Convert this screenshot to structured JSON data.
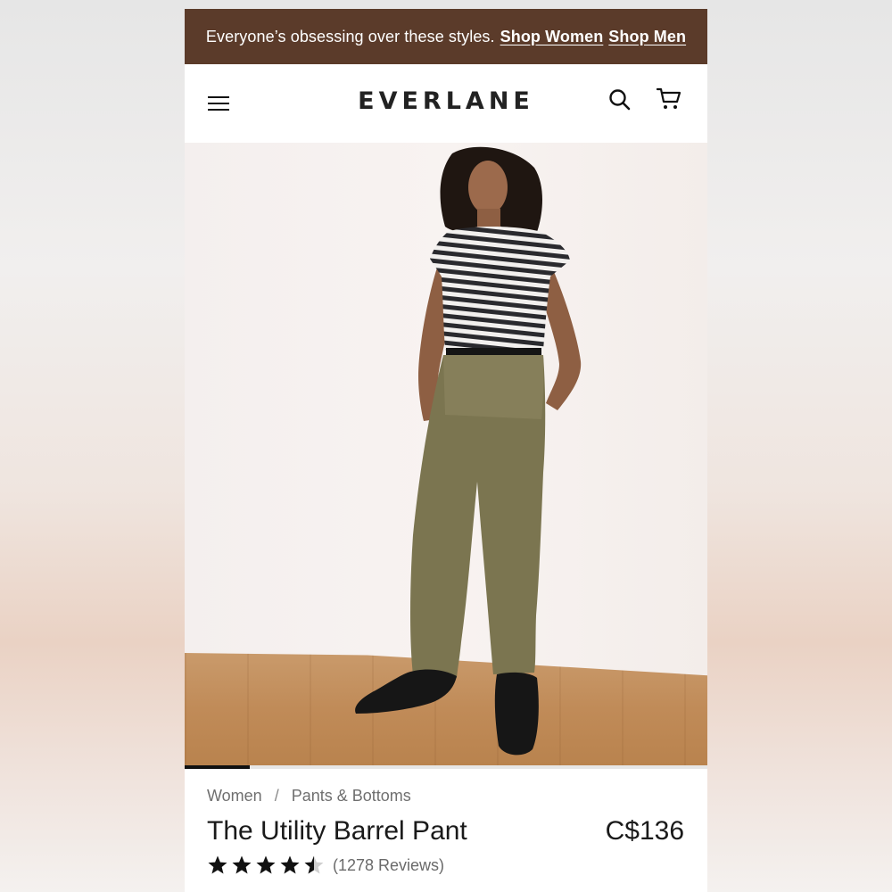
{
  "banner": {
    "text": "Everyone’s obsessing over these styles.",
    "link_women": "Shop Women",
    "link_men": "Shop Men"
  },
  "header": {
    "logo": "EVERLANE",
    "icons": [
      "menu-icon",
      "search-icon",
      "cart-icon"
    ]
  },
  "gallery": {
    "progress": 0.125
  },
  "product": {
    "breadcrumb": [
      "Women",
      "Pants & Bottoms"
    ],
    "breadcrumb_separator": "/",
    "title": "The Utility Barrel Pant",
    "price": "C$136",
    "rating": 4.5,
    "reviews": "(1278 Reviews)"
  },
  "colors": {
    "banner_bg": "#5b3b2a",
    "text": "#1a1a1a",
    "muted": "#6f6f6f"
  }
}
